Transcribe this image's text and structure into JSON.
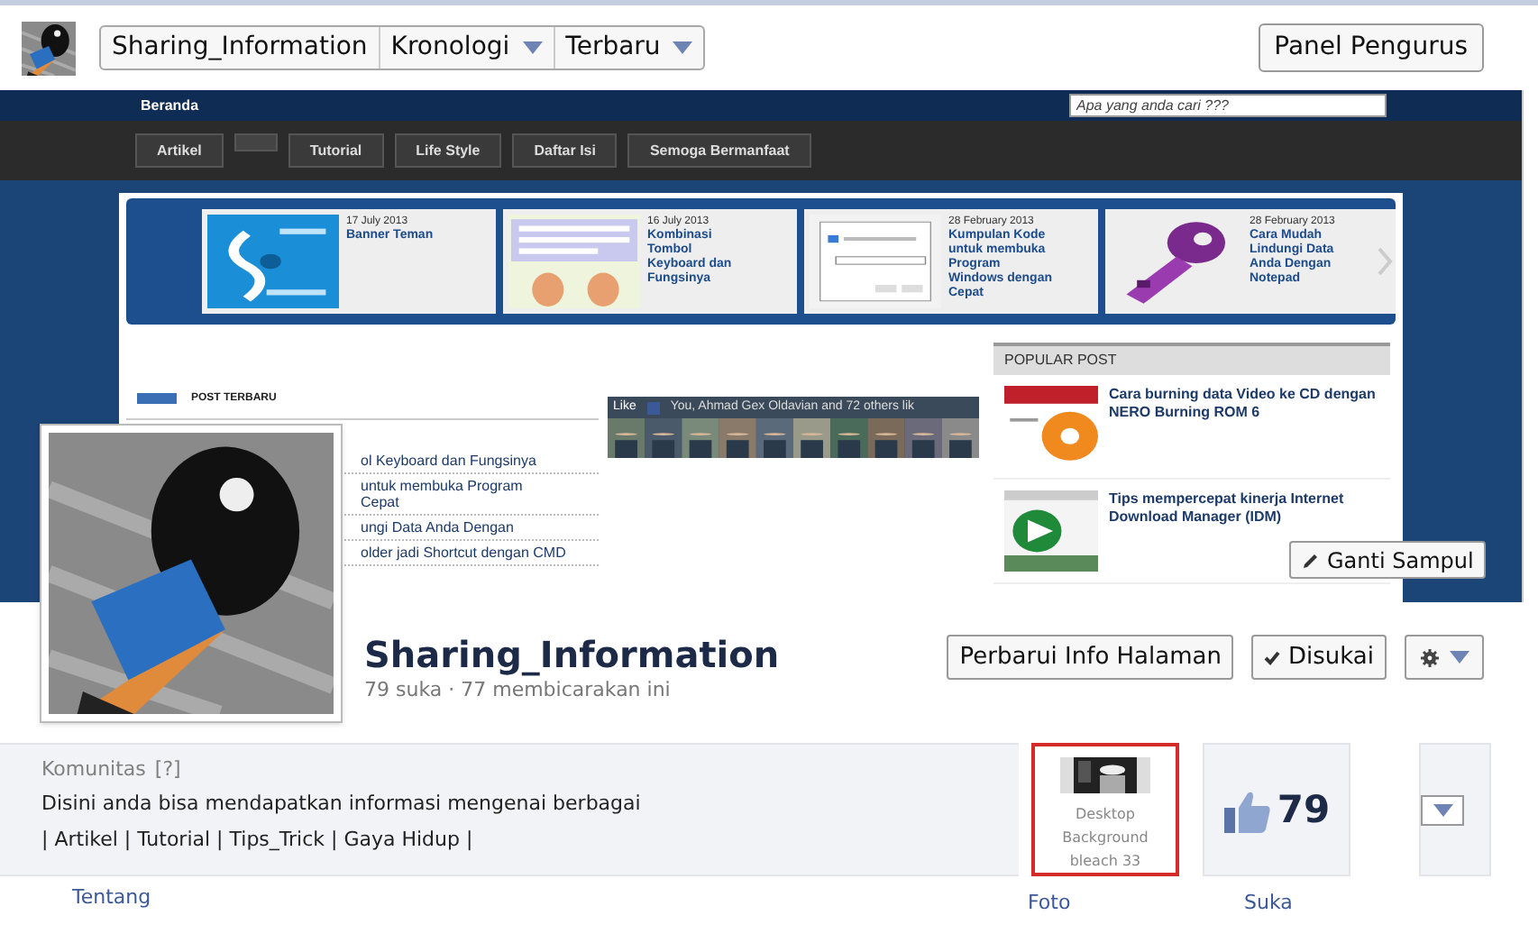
{
  "header": {
    "page_name": "Sharing_Information",
    "view_menus": [
      {
        "label": "Kronologi"
      },
      {
        "label": "Terbaru"
      }
    ],
    "admin_button": "Panel Pengurus"
  },
  "cover": {
    "blog": {
      "top_link": "Beranda",
      "search_placeholder": "Apa yang anda cari ???",
      "menu": [
        {
          "kind": "text",
          "label": "Artikel"
        },
        {
          "kind": "blank"
        },
        {
          "kind": "text",
          "label": "Tutorial"
        },
        {
          "kind": "text",
          "label": "Life Style"
        },
        {
          "kind": "text",
          "label": "Daftar Isi"
        },
        {
          "kind": "text",
          "label": "Semoga Bermanfaat"
        }
      ],
      "slider": [
        {
          "date": "17 July 2013",
          "title": "Banner Teman"
        },
        {
          "date": "16 July 2013",
          "title": "Kombinasi Tombol Keyboard dan Fungsinya"
        },
        {
          "date": "28 February 2013",
          "title": "Kumpulan Kode untuk membuka Program Windows dengan Cepat"
        },
        {
          "date": "28 February 2013",
          "title": "Cara Mudah Lindungi Data Anda Dengan Notepad"
        }
      ],
      "recent_posts": {
        "heading": "POST TERBARU",
        "items": [
          {
            "lines": [
              "ol Keyboard dan Fungsinya"
            ]
          },
          {
            "lines": [
              "untuk membuka Program",
              "Cepat"
            ]
          },
          {
            "lines": [
              "ungi Data Anda Dengan"
            ]
          },
          {
            "lines": [
              "older jadi Shortcut dengan CMD"
            ]
          }
        ]
      },
      "like_box": {
        "like": "Like",
        "text": "You, Ahmad Gex Oldavian and 72 others lik"
      },
      "popular": {
        "heading": "POPULAR POST",
        "items": [
          {
            "title": "Cara burning data Video ke CD dengan NERO Burning ROM 6"
          },
          {
            "title": "Tips mempercepat kinerja Internet Download Manager (IDM)"
          }
        ]
      }
    },
    "change_cover_button": "Ganti Sampul"
  },
  "profile": {
    "name": "Sharing_Information",
    "stats": "79 suka · 77 membicarakan ini",
    "update_button": "Perbarui Info Halaman",
    "liked_button": "Disukai"
  },
  "about": {
    "category": "Komunitas",
    "help": "[?]",
    "description": "Disini anda bisa mendapatkan informasi mengenai berbagai",
    "tags": "| Artikel | Tutorial | Tips_Trick | Gaya Hidup |",
    "tab": "Tentang"
  },
  "apps": [
    {
      "caption": "Desktop Background bleach 33",
      "label": "Foto",
      "selected": true
    },
    {
      "kind": "likes",
      "count": "79",
      "label": "Suka",
      "selected": false
    }
  ]
}
